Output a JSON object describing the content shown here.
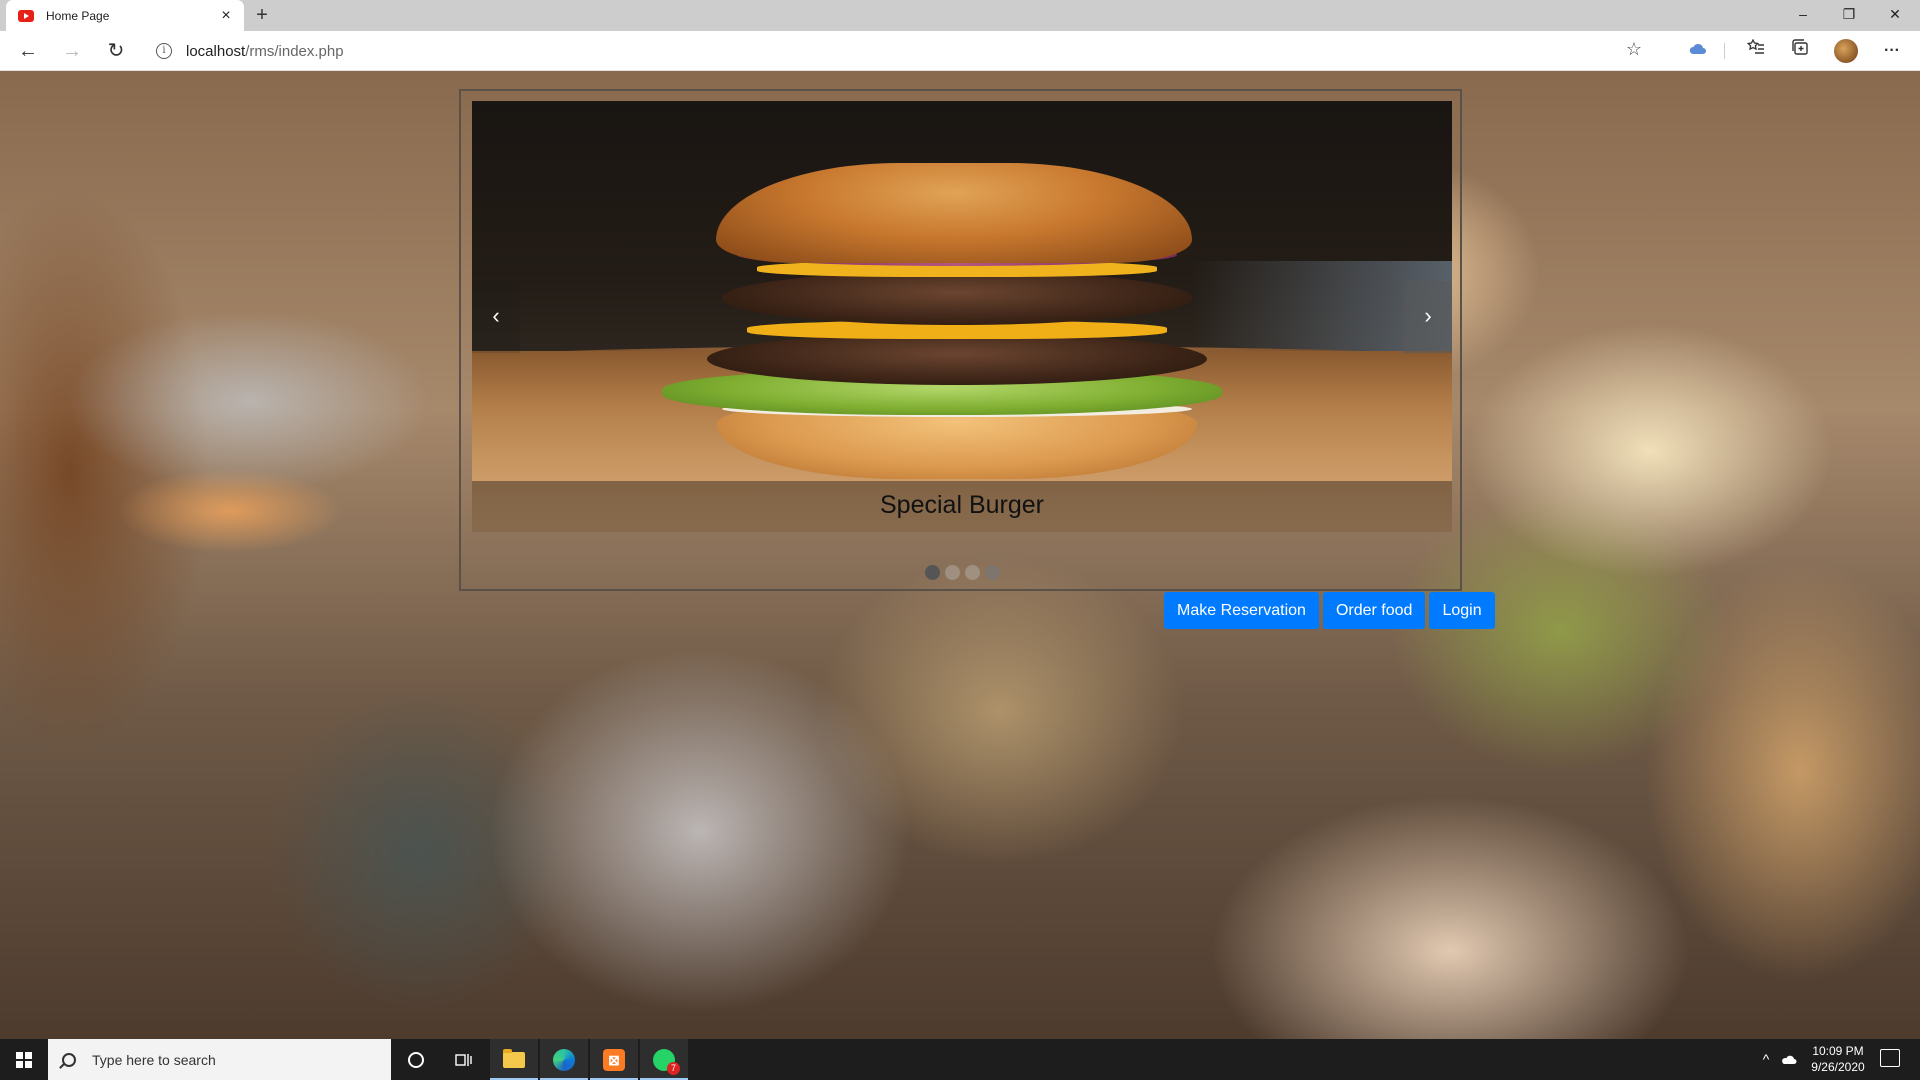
{
  "browser": {
    "tab_title": "Home Page",
    "tab_close": "×",
    "new_tab": "+",
    "url_host": "localhost",
    "url_path": "/rms/index.php",
    "info_glyph": "i",
    "back_glyph": "←",
    "forward_glyph": "→",
    "refresh_glyph": "↻",
    "star_glyph": "☆",
    "more_glyph": "···",
    "minimize_glyph": "–",
    "restore_glyph": "❐",
    "close_glyph": "✕"
  },
  "carousel": {
    "caption": "Special Burger",
    "prev_glyph": "‹",
    "next_glyph": "›",
    "slide_count": 4,
    "active_index": 0
  },
  "actions": {
    "reservation_label": "Make Reservation",
    "order_label": "Order food",
    "login_label": "Login"
  },
  "taskbar": {
    "search_placeholder": "Type here to search",
    "time": "10:09 PM",
    "date": "9/26/2020",
    "whatsapp_badge": "7",
    "xampp_glyph": "⊠",
    "chevron_up_glyph": "^"
  },
  "colors": {
    "primary_button": "#007bff",
    "taskbar": "#1d1d1d"
  }
}
